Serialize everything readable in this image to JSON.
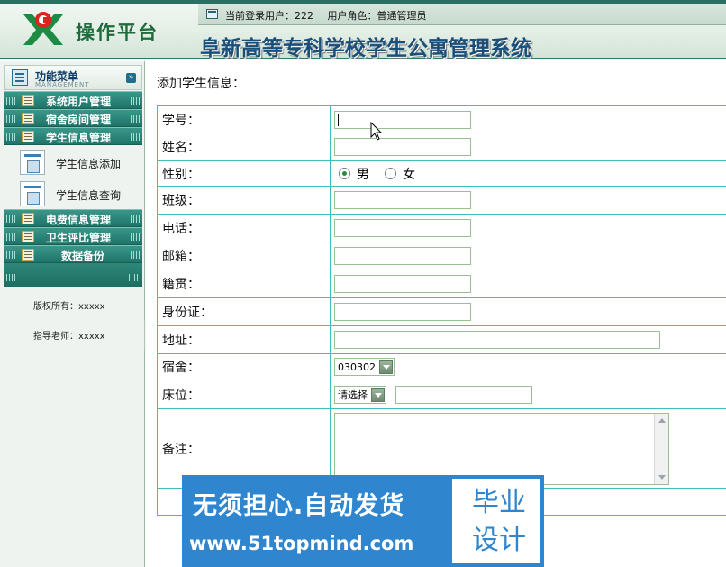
{
  "header": {
    "platform_title": "操作平台",
    "system_title": "阜新高等专科学校学生公寓管理系统",
    "login_user_label": "当前登录用户：222",
    "user_role_label": "用户角色：普通管理员"
  },
  "sidebar": {
    "menu_title": "功能菜单",
    "menu_subtitle": "MANAGEMENT",
    "sections": [
      {
        "label": "系统用户管理"
      },
      {
        "label": "宿舍房间管理"
      },
      {
        "label": "学生信息管理"
      },
      {
        "label": "电费信息管理"
      },
      {
        "label": "卫生评比管理"
      },
      {
        "label": "数据备份"
      }
    ],
    "sub_items": [
      {
        "label": "学生信息添加"
      },
      {
        "label": "学生信息查询"
      }
    ],
    "copyright": "版权所有：xxxxx",
    "advisor": "指导老师：xxxxx"
  },
  "main": {
    "page_title": "添加学生信息：",
    "form": {
      "labels": {
        "student_id": "学号：",
        "name": "姓名：",
        "gender": "性别：",
        "class": "班级：",
        "phone": "电话：",
        "email": "邮箱：",
        "hometown": "籍贯：",
        "id_card": "身份证：",
        "address": "地址：",
        "dorm": "宿舍：",
        "bed": "床位：",
        "remark": "备注："
      },
      "gender_options": [
        "男",
        "女"
      ],
      "gender_selected": "男",
      "dorm_selected": "030302",
      "bed_selected": "请选择"
    }
  },
  "watermark": {
    "slogan": "无须担心.自动发货",
    "url": "www.51topmind.com",
    "badge_line1": "毕业",
    "badge_line2": "设计"
  }
}
